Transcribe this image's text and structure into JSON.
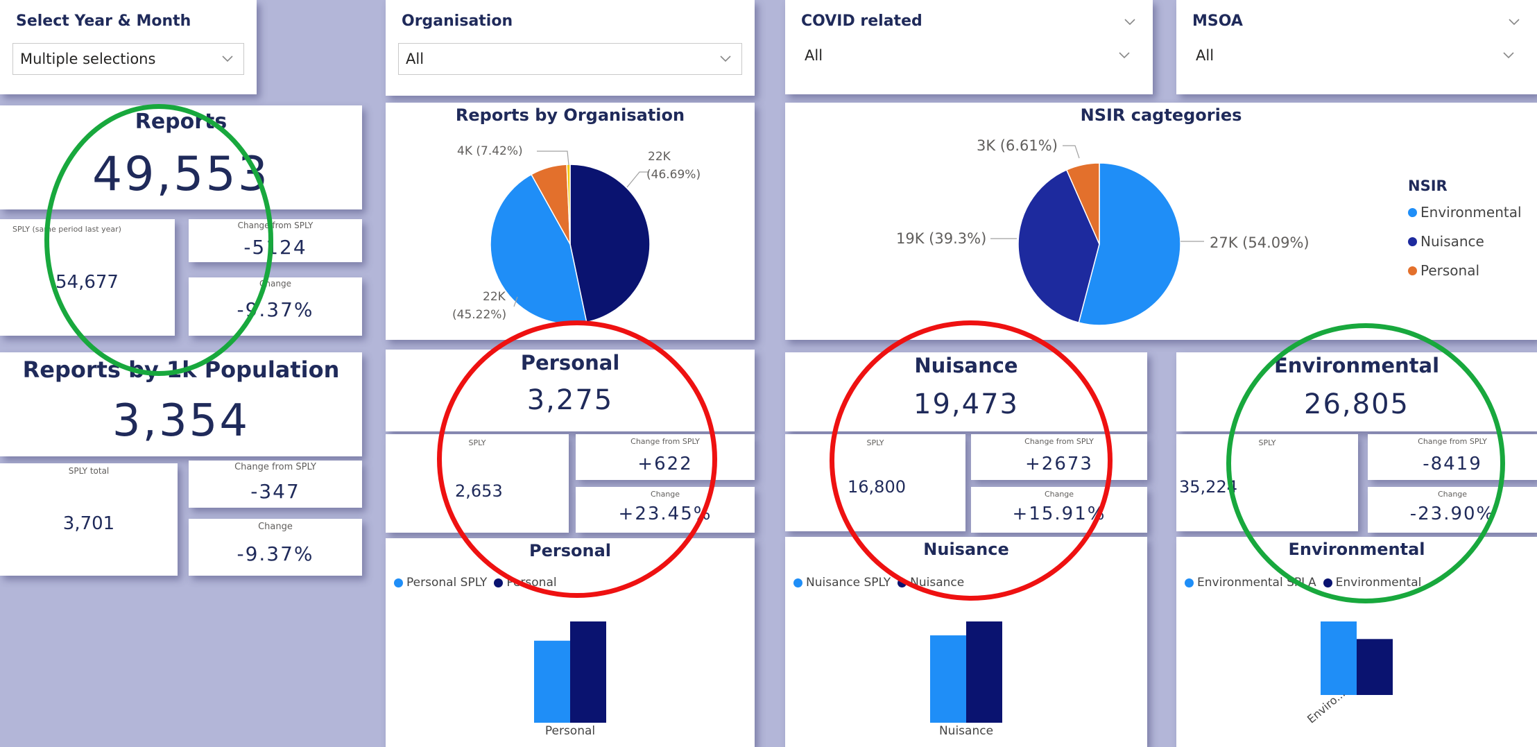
{
  "colors": {
    "dark_blue": "#0a1370",
    "light_blue": "#1f8ef7",
    "orange": "#e3702c",
    "navy_blue": "#1d2a9e",
    "green_circle": "#18a83d",
    "red_circle": "#ee1111"
  },
  "slicers": {
    "year_month": {
      "title": "Select Year & Month",
      "value": "Multiple selections",
      "icon": "chevron-down-icon"
    },
    "organisation": {
      "title": "Organisation",
      "value": "All",
      "icon": "chevron-down-icon"
    },
    "covid": {
      "title": "COVID related",
      "value": "All",
      "icon": "chevron-down-icon"
    },
    "msoa": {
      "title": "MSOA",
      "value": "All",
      "icon": "chevron-down-icon"
    }
  },
  "reports": {
    "title": "Reports",
    "value": "49,553",
    "sply_label": "SPLY (same period last year)",
    "sply_value": "54,677",
    "change_label": "Change from SPLY",
    "change_value": "-5124",
    "pct_label": "Change",
    "pct_value": "-9.37%"
  },
  "per_1k": {
    "title": "Reports by 1k Population",
    "value": "3,354",
    "sply_label": "SPLY total",
    "sply_value": "3,701",
    "change_label": "Change from SPLY",
    "change_value": "-347",
    "pct_label": "Change",
    "pct_value": "-9.37%"
  },
  "org_pie": {
    "title": "Reports by Organisation",
    "slices": [
      {
        "label": "22K (46.69%)",
        "pct": 46.69,
        "color": "#0a1370"
      },
      {
        "label": "22K (45.22%)",
        "pct": 45.22,
        "color": "#1f8ef7"
      },
      {
        "label": "4K (7.42%)",
        "pct": 7.42,
        "color": "#e3702c"
      },
      {
        "label": "",
        "pct": 0.67,
        "color": "#f2c80f"
      }
    ],
    "label_right_line1": "22K",
    "label_right_line2": "(46.69%)",
    "label_bottom_line1": "22K",
    "label_bottom_line2": "(45.22%)",
    "label_top": "4K (7.42%)"
  },
  "nsir_pie": {
    "title": "NSIR cagtegories",
    "slices": [
      {
        "label": "27K (54.09%)",
        "pct": 54.09,
        "color": "#1f8ef7"
      },
      {
        "label": "19K (39.3%)",
        "pct": 39.3,
        "color": "#1d2a9e"
      },
      {
        "label": "3K (6.61%)",
        "pct": 6.61,
        "color": "#e3702c"
      }
    ],
    "legend_title": "NSIR",
    "legend": [
      {
        "name": "Environmental",
        "color": "#1f8ef7"
      },
      {
        "name": "Nuisance",
        "color": "#1d2a9e"
      },
      {
        "name": "Personal",
        "color": "#e3702c"
      }
    ]
  },
  "categories": [
    {
      "key": "personal",
      "title": "Personal",
      "value": "3,275",
      "sply_label": "SPLY",
      "sply_value": "2,653",
      "change_label": "Change from SPLY",
      "change_value": "+622",
      "pct_label": "Change",
      "pct_value": "+23.45%",
      "bar_title": "Personal",
      "legend_sply": "Personal SPLY",
      "legend_current": "Personal",
      "axis_label": "Personal",
      "bars": {
        "sply": 2653,
        "current": 3275,
        "max": 3275
      }
    },
    {
      "key": "nuisance",
      "title": "Nuisance",
      "value": "19,473",
      "sply_label": "SPLY",
      "sply_value": "16,800",
      "change_label": "Change from SPLY",
      "change_value": "+2673",
      "pct_label": "Change",
      "pct_value": "+15.91%",
      "bar_title": "Nuisance",
      "legend_sply": "Nuisance SPLY",
      "legend_current": "Nuisance",
      "axis_label": "Nuisance",
      "bars": {
        "sply": 16800,
        "current": 19473,
        "max": 19473
      }
    },
    {
      "key": "environmental",
      "title": "Environmental",
      "value": "26,805",
      "sply_label": "SPLY",
      "sply_value": "35,224",
      "change_label": "Change from SPLY",
      "change_value": "-8419",
      "pct_label": "Change",
      "pct_value": "-23.90%",
      "bar_title": "Environmental",
      "legend_sply": "Environmental SPLA",
      "legend_current": "Environmental",
      "axis_label": "Enviro...",
      "bars": {
        "sply": 35224,
        "current": 26805,
        "max": 35224
      }
    }
  ]
}
